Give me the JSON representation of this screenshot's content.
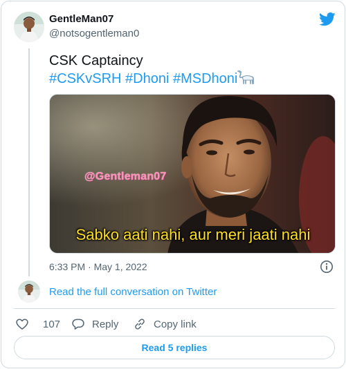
{
  "author": {
    "name": "GentleMan07",
    "handle": "@notsogentleman0"
  },
  "tweet": {
    "text_line1": "CSK Captaincy",
    "hashtags": "#CSKvSRH #Dhoni #MSDhoni",
    "emoji": "goat-emoji",
    "timestamp": "6:33 PM · May 1, 2022"
  },
  "media": {
    "watermark": "@Gentleman07",
    "caption": "Sabko aati nahi, aur meri jaati nahi"
  },
  "conversation_link": "Read the full conversation on Twitter",
  "actions": {
    "like_count": "107",
    "reply_label": "Reply",
    "copy_label": "Copy link"
  },
  "read_replies_label": "Read 5 replies",
  "colors": {
    "accent": "#1d9bf0",
    "text": "#0f1419",
    "muted": "#536471",
    "border": "#cfd9de",
    "caption": "#ffdf21",
    "watermark": "#ff8fb7"
  },
  "icons": [
    "twitter-bird-icon",
    "info-icon",
    "heart-icon",
    "reply-bubble-icon",
    "link-icon"
  ]
}
